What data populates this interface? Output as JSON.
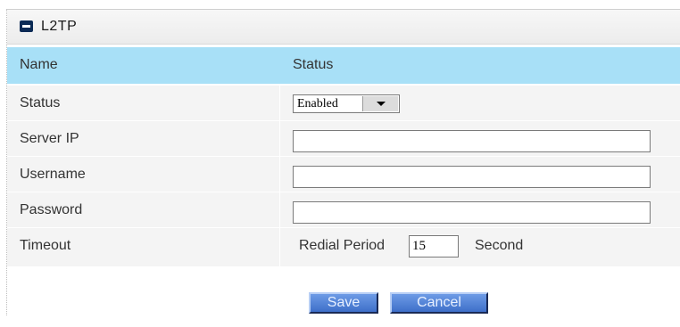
{
  "panel": {
    "title": "L2TP",
    "icon": "minus-square-icon"
  },
  "columns": {
    "name": "Name",
    "status": "Status"
  },
  "rows": {
    "status": {
      "label": "Status",
      "value": "Enabled"
    },
    "server_ip": {
      "label": "Server IP",
      "value": ""
    },
    "username": {
      "label": "Username",
      "value": ""
    },
    "password": {
      "label": "Password",
      "value": ""
    },
    "timeout": {
      "label": "Timeout",
      "prefix": "Redial Period",
      "value": "15",
      "suffix": "Second"
    }
  },
  "actions": {
    "save": "Save",
    "cancel": "Cancel"
  },
  "colors": {
    "header_bg": "#a8e0f7",
    "row_bg": "#f4f4f4",
    "button": "#4a7bd6"
  }
}
